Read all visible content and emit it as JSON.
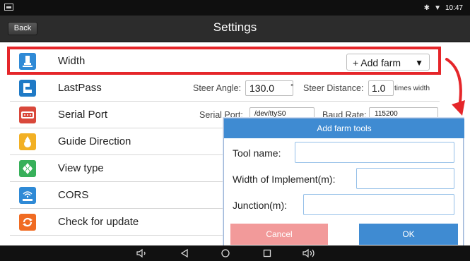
{
  "status_bar": {
    "time": "10:47",
    "icons": [
      "notification-icon",
      "bluetooth-icon",
      "wifi-icon"
    ]
  },
  "header": {
    "back_label": "Back",
    "title": "Settings"
  },
  "settings": {
    "items": [
      {
        "label": "Width",
        "icon": "width-icon"
      },
      {
        "label": "LastPass",
        "icon": "lastpass-icon"
      },
      {
        "label": "Serial Port",
        "icon": "serial-port-icon"
      },
      {
        "label": "Guide Direction",
        "icon": "guide-direction-icon"
      },
      {
        "label": "View type",
        "icon": "view-type-icon"
      },
      {
        "label": "CORS",
        "icon": "cors-icon"
      },
      {
        "label": "Check for update",
        "icon": "update-icon"
      }
    ],
    "width_dropdown": {
      "value": "+ Add farm"
    },
    "lastpass": {
      "steer_angle_label": "Steer Angle:",
      "steer_angle_value": "130.0",
      "steer_angle_unit": "°",
      "steer_distance_label": "Steer Distance:",
      "steer_distance_value": "1.0",
      "steer_distance_unit": "times width"
    },
    "serial_port": {
      "port_label": "Serial Port:",
      "port_value": "/dev/ttyS0",
      "baud_label": "Baud Rate:",
      "baud_value": "115200"
    }
  },
  "dialog": {
    "title": "Add farm tools",
    "fields": [
      {
        "label": "Tool name:",
        "value": ""
      },
      {
        "label": "Width of Implement(m):",
        "value": ""
      },
      {
        "label": "Junction(m):",
        "value": ""
      }
    ],
    "cancel_label": "Cancel",
    "ok_label": "OK"
  },
  "colors": {
    "highlight": "#e5262a",
    "dialog_header": "#3f8bd2",
    "cancel": "#f29a9a",
    "ok": "#3f8bd2"
  },
  "nav_bar": {
    "icons": [
      "volume-down-icon",
      "back-icon",
      "home-icon",
      "recents-icon",
      "volume-up-icon"
    ]
  }
}
